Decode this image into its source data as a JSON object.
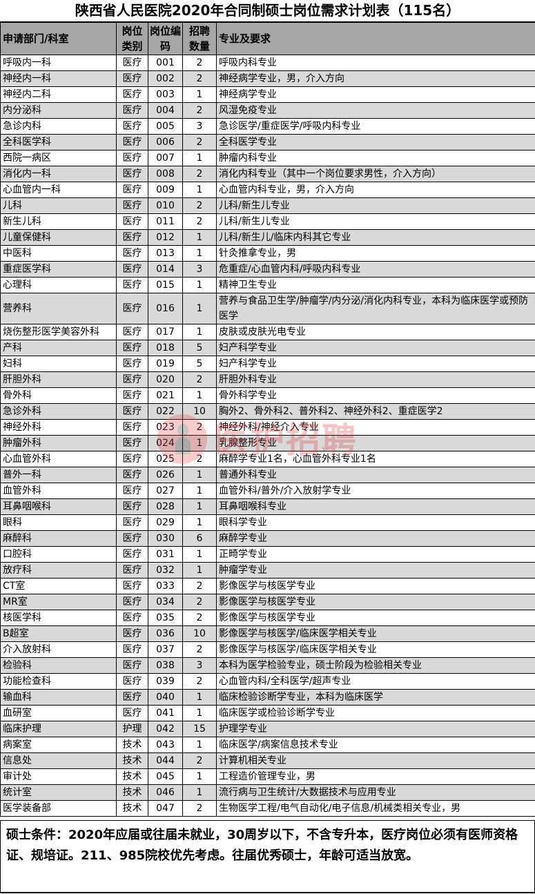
{
  "title": "陕西省人民医院2020年合同制硕士岗位需求计划表（115名）",
  "headers": {
    "dept": "申请部门/科室",
    "category": "岗位类别",
    "code": "岗位编码",
    "count": "招聘数量",
    "requirement": "专业及要求"
  },
  "rows": [
    {
      "dept": "呼吸内一科",
      "category": "医疗",
      "code": "001",
      "count": "2",
      "requirement": "呼吸内科专业"
    },
    {
      "dept": "神经内一科",
      "category": "医疗",
      "code": "002",
      "count": "2",
      "requirement": "神经病学专业，男，介入方向"
    },
    {
      "dept": "神经内二科",
      "category": "医疗",
      "code": "003",
      "count": "1",
      "requirement": "神经病学专业"
    },
    {
      "dept": "内分泌科",
      "category": "医疗",
      "code": "004",
      "count": "2",
      "requirement": "风湿免疫专业"
    },
    {
      "dept": "急诊内科",
      "category": "医疗",
      "code": "005",
      "count": "3",
      "requirement": "急诊医学/重症医学/呼吸内科专业"
    },
    {
      "dept": "全科医学科",
      "category": "医疗",
      "code": "006",
      "count": "2",
      "requirement": "全科医学专业"
    },
    {
      "dept": "西院一病区",
      "category": "医疗",
      "code": "007",
      "count": "1",
      "requirement": "肿瘤内科专业"
    },
    {
      "dept": "消化内一科",
      "category": "医疗",
      "code": "008",
      "count": "2",
      "requirement": "消化内科专业（其中一个岗位要求男性，介入方向）"
    },
    {
      "dept": "心血管内一科",
      "category": "医疗",
      "code": "009",
      "count": "1",
      "requirement": "心血管内科专业，男，介入方向"
    },
    {
      "dept": "儿科",
      "category": "医疗",
      "code": "010",
      "count": "2",
      "requirement": "儿科/新生儿专业"
    },
    {
      "dept": "新生儿科",
      "category": "医疗",
      "code": "011",
      "count": "2",
      "requirement": "儿科/新生儿专业"
    },
    {
      "dept": "儿童保健科",
      "category": "医疗",
      "code": "012",
      "count": "1",
      "requirement": "儿科/新生儿/临床内科其它专业"
    },
    {
      "dept": "中医科",
      "category": "医疗",
      "code": "013",
      "count": "1",
      "requirement": "针灸推拿专业，男"
    },
    {
      "dept": "重症医学科",
      "category": "医疗",
      "code": "014",
      "count": "3",
      "requirement": "危重症/心血管内科/呼吸内科专业"
    },
    {
      "dept": "心理科",
      "category": "医疗",
      "code": "015",
      "count": "1",
      "requirement": "精神卫生专业"
    },
    {
      "dept": "营养科",
      "category": "医疗",
      "code": "016",
      "count": "1",
      "requirement": "营养与食品卫生学/肿瘤学/内分泌/消化内科专业，本科为临床医学或预防医学"
    },
    {
      "dept": "烧伤整形医学美容外科",
      "category": "医疗",
      "code": "017",
      "count": "1",
      "requirement": "皮肤或皮肤光电专业"
    },
    {
      "dept": "产科",
      "category": "医疗",
      "code": "018",
      "count": "5",
      "requirement": "妇产科学专业"
    },
    {
      "dept": "妇科",
      "category": "医疗",
      "code": "019",
      "count": "5",
      "requirement": "妇产科学专业"
    },
    {
      "dept": "肝胆外科",
      "category": "医疗",
      "code": "020",
      "count": "2",
      "requirement": "肝胆外科专业"
    },
    {
      "dept": "骨外科",
      "category": "医疗",
      "code": "021",
      "count": "1",
      "requirement": "骨外科学专业"
    },
    {
      "dept": "急诊外科",
      "category": "医疗",
      "code": "022",
      "count": "10",
      "requirement": "胸外2、骨外科2、普外科2、神经外科2、重症医学2"
    },
    {
      "dept": "神经外科",
      "category": "医疗",
      "code": "023",
      "count": "2",
      "requirement": "神经外科/神经介入专业"
    },
    {
      "dept": "肿瘤外科",
      "category": "医疗",
      "code": "024",
      "count": "1",
      "requirement": "乳腺整形专业"
    },
    {
      "dept": "心血管外科",
      "category": "医疗",
      "code": "025",
      "count": "2",
      "requirement": "麻醉学专业1名，心血管外科专业1名"
    },
    {
      "dept": "普外一科",
      "category": "医疗",
      "code": "026",
      "count": "1",
      "requirement": "普通外科专业"
    },
    {
      "dept": "血管外科",
      "category": "医疗",
      "code": "027",
      "count": "1",
      "requirement": "血管外科/普外/介入放射学专业"
    },
    {
      "dept": "耳鼻咽喉科",
      "category": "医疗",
      "code": "028",
      "count": "1",
      "requirement": "耳鼻咽喉科专业"
    },
    {
      "dept": "眼科",
      "category": "医疗",
      "code": "029",
      "count": "1",
      "requirement": "眼科学专业"
    },
    {
      "dept": "麻醉科",
      "category": "医疗",
      "code": "030",
      "count": "6",
      "requirement": "麻醉学专业"
    },
    {
      "dept": "口腔科",
      "category": "医疗",
      "code": "031",
      "count": "1",
      "requirement": "正畸学专业"
    },
    {
      "dept": "放疗科",
      "category": "医疗",
      "code": "032",
      "count": "1",
      "requirement": "肿瘤学专业"
    },
    {
      "dept": "CT室",
      "category": "医疗",
      "code": "033",
      "count": "2",
      "requirement": "影像医学与核医学专业"
    },
    {
      "dept": "MR室",
      "category": "医疗",
      "code": "034",
      "count": "2",
      "requirement": "影像医学与核医学专业"
    },
    {
      "dept": "核医学科",
      "category": "医疗",
      "code": "035",
      "count": "2",
      "requirement": "影像医学与核医学专业"
    },
    {
      "dept": "B超室",
      "category": "医疗",
      "code": "036",
      "count": "10",
      "requirement": "影像医学与核医学/临床医学相关专业"
    },
    {
      "dept": "介入放射科",
      "category": "医疗",
      "code": "037",
      "count": "2",
      "requirement": "影像医学与核医学/临床医学相关专业"
    },
    {
      "dept": "检验科",
      "category": "医疗",
      "code": "038",
      "count": "3",
      "requirement": "本科为医学检验专业，硕士阶段为检验相关专业"
    },
    {
      "dept": "功能检查科",
      "category": "医疗",
      "code": "039",
      "count": "2",
      "requirement": "心血管内科/全科医学/超声专业"
    },
    {
      "dept": "输血科",
      "category": "医疗",
      "code": "040",
      "count": "1",
      "requirement": "临床检验诊断学专业，本科为临床医学"
    },
    {
      "dept": "血研室",
      "category": "医疗",
      "code": "041",
      "count": "1",
      "requirement": "临床医学或检验诊断学专业"
    },
    {
      "dept": "临床护理",
      "category": "护理",
      "code": "042",
      "count": "15",
      "requirement": "护理学专业"
    },
    {
      "dept": "病案室",
      "category": "技术",
      "code": "043",
      "count": "1",
      "requirement": "临床医学/病案信息技术专业"
    },
    {
      "dept": "信息处",
      "category": "技术",
      "code": "044",
      "count": "2",
      "requirement": "计算机相关专业"
    },
    {
      "dept": "审计处",
      "category": "技术",
      "code": "045",
      "count": "1",
      "requirement": "工程造价管理专业，男"
    },
    {
      "dept": "统计室",
      "category": "技术",
      "code": "046",
      "count": "1",
      "requirement": "流行病与卫生统计/大数据技术与应用专业"
    },
    {
      "dept": "医学装备部",
      "category": "技术",
      "code": "047",
      "count": "2",
      "requirement": "生物医学工程/电气自动化/电子信息/机械类相关专业，男"
    }
  ],
  "note": "硕士条件：2020年应届或往届未就业，30周岁以下，不含专升本，医疗岗位必须有医师资格证、规培证。211、985院校优先考虑。往届优秀硕士，年龄可适当放宽。",
  "watermark": "医护招聘",
  "colors": {
    "header_bg": "#a6a6a6",
    "alt_row_bg": "#d9d9d9",
    "watermark": "#e03030"
  }
}
